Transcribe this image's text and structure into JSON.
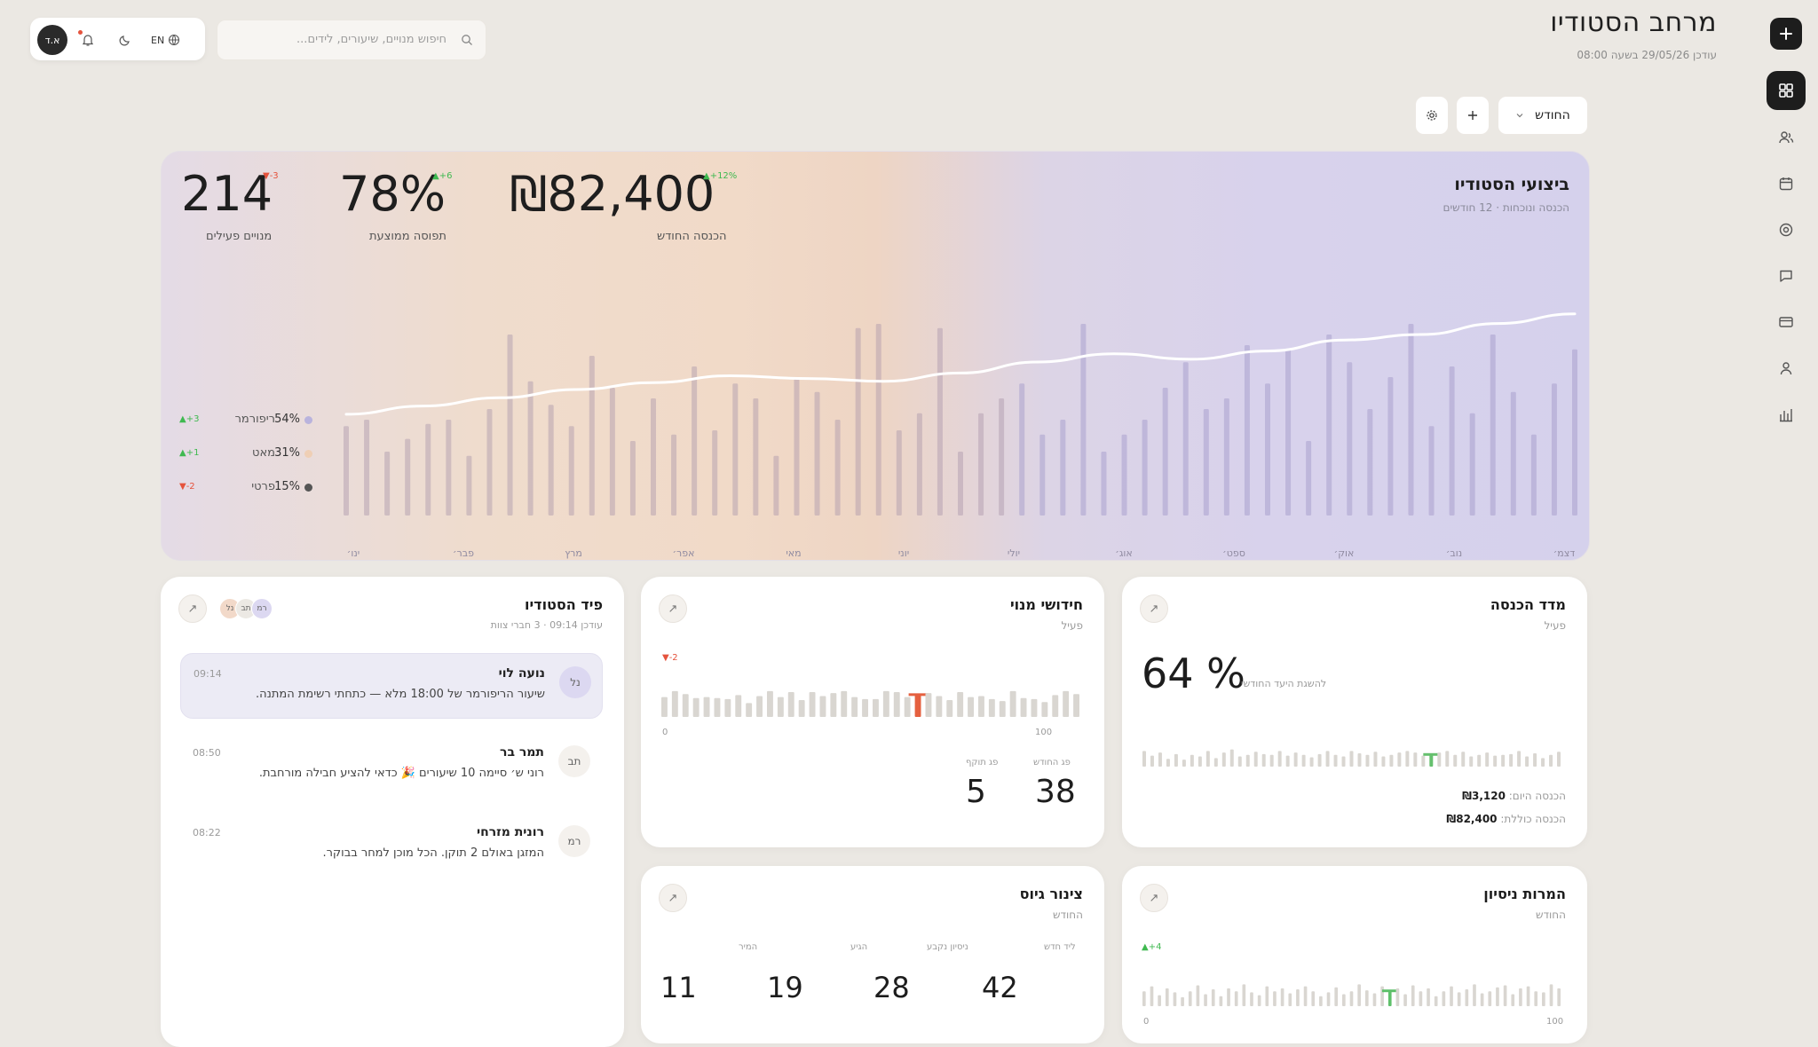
{
  "header": {
    "title": "מרחב הסטודיו",
    "updated": "עודכן 29/05/26 בשעה 08:00"
  },
  "topbar": {
    "avatar_initials": "א.ד",
    "lang": "EN",
    "search_placeholder": "חיפוש מנויים, שיעורים, לידים..."
  },
  "controls": {
    "period_label": "החודש"
  },
  "hero": {
    "title": "ביצועי הסטודיו",
    "subtitle": "הכנסה ונוכחות · 12 חודשים",
    "kpis": [
      {
        "value": "₪82,400",
        "label": "הכנסה החודש",
        "delta": "▲+12%",
        "delta_color": "#3fb950"
      },
      {
        "value": "78%",
        "label": "תפוסה ממוצעת",
        "delta": "▲+6",
        "delta_color": "#3fb950"
      },
      {
        "value": "214",
        "label": "מנויים פעילים",
        "delta": "▼-3",
        "delta_color": "#e5533d"
      }
    ],
    "legend": [
      {
        "pct": "54%",
        "name": "ריפורמר",
        "delta": "▲+3",
        "delta_color": "#3fb950",
        "dot": "#b9b3dd"
      },
      {
        "pct": "31%",
        "name": "מאט",
        "delta": "▲+1",
        "delta_color": "#3fb950",
        "dot": "#efcfb5"
      },
      {
        "pct": "15%",
        "name": "פרטי",
        "delta": "▼-2",
        "delta_color": "#e5533d",
        "dot": "#555555"
      }
    ],
    "months": [
      "ינו׳",
      "פבר׳",
      "מרץ",
      "אפר׳",
      "מאי",
      "יוני",
      "יולי",
      "אוג׳",
      "ספט׳",
      "אוק׳",
      "נוב׳",
      "דצמ׳"
    ]
  },
  "chart_data": {
    "type": "bar",
    "categories": [
      "ינו׳",
      "פבר׳",
      "מרץ",
      "אפר׳",
      "מאי",
      "יוני",
      "יולי",
      "אוג׳",
      "ספט׳",
      "אוק׳",
      "נוב׳",
      "דצמ׳"
    ],
    "bars": [
      42,
      45,
      30,
      36,
      43,
      45,
      28,
      50,
      85,
      63,
      52,
      42,
      75,
      60,
      35,
      55,
      38,
      70,
      40,
      62,
      55,
      28,
      65,
      58,
      45,
      88,
      90,
      40,
      48,
      88,
      30,
      48,
      55,
      62,
      38,
      45,
      90,
      30,
      38,
      45,
      60,
      72,
      50,
      55,
      80,
      62,
      78,
      35,
      85,
      72,
      50,
      65,
      90,
      42,
      70,
      48,
      85,
      58,
      38,
      62,
      78
    ],
    "line": [
      0.22,
      0.28,
      0.34,
      0.4,
      0.45,
      0.5,
      0.48,
      0.46,
      0.52,
      0.6,
      0.66,
      0.62,
      0.68,
      0.76,
      0.8,
      0.88,
      0.95
    ],
    "ylim": [
      0,
      100
    ]
  },
  "feed": {
    "title": "פיד הסטודיו",
    "subtitle": "עודכן 09:14 · 3 חברי צוות",
    "team": [
      "נל",
      "תב",
      "רמ"
    ],
    "items": [
      {
        "initials": "נל",
        "name": "נועה לוי",
        "msg": "שיעור הריפורמר של 18:00 מלא — כתחתי רשימת המתנה.",
        "time": "09:14"
      },
      {
        "initials": "תב",
        "name": "תמר בר",
        "msg": "רוני ש׳ סיימה 10 שיעורים 🎉 כדאי להציע חבילה מורחבת.",
        "time": "08:50"
      },
      {
        "initials": "רמ",
        "name": "רונית מזרחי",
        "msg": "המזגן באולם 2 תוקן. הכל מוכן למחר בבוקר.",
        "time": "08:22"
      }
    ]
  },
  "renewals": {
    "title": "חידושי מנוי",
    "subtitle": "פעיל",
    "delta": "▼-2",
    "axis_min": "0",
    "axis_max": "100",
    "label_new": "פג החודש",
    "label_expired": "פג תוקף",
    "value_new": "38",
    "value_expired": "5",
    "bars": [
      40,
      52,
      46,
      38,
      40,
      38,
      36,
      44,
      28,
      42,
      52,
      40,
      50,
      34,
      50,
      42,
      48,
      52,
      40,
      36,
      36,
      52,
      50,
      40,
      44,
      48,
      42,
      34,
      50,
      40,
      42,
      36,
      32,
      52,
      38,
      36,
      30,
      44,
      52,
      46
    ],
    "highlight": 24
  },
  "revenue_gauge": {
    "title": "מדד הכנסה",
    "subtitle": "פעיל",
    "value": "64 %",
    "note": "להשגת היעד החודשי",
    "today_label": "הכנסה היום:",
    "today_value": "₪3,120",
    "total_label": "הכנסה כוללת:",
    "total_value": "₪82,400",
    "bars": [
      40,
      28,
      36,
      20,
      32,
      18,
      30,
      26,
      40,
      22,
      36,
      44,
      26,
      30,
      38,
      32,
      30,
      40,
      28,
      36,
      30,
      24,
      32,
      40,
      30,
      26,
      40,
      34,
      30,
      38,
      26,
      30,
      36,
      40,
      36,
      28,
      30,
      36,
      40,
      30,
      38,
      26,
      30,
      36,
      28,
      30,
      32,
      40,
      26,
      34,
      22,
      30,
      38
    ],
    "highlight": 36
  },
  "pipeline": {
    "title": "צינור גיוס",
    "subtitle": "החודש",
    "stages": [
      {
        "label": "ליד חדש",
        "value": "42"
      },
      {
        "label": "ניסיון נקבע",
        "value": "28"
      },
      {
        "label": "הגיע",
        "value": "19"
      },
      {
        "label": "המיר",
        "value": "11"
      }
    ]
  },
  "trials": {
    "title": "המרות ניסיון",
    "subtitle": "החודש",
    "delta": "▲+4",
    "axis_min": "0",
    "axis_max": "100",
    "bars": [
      30,
      40,
      22,
      36,
      28,
      18,
      30,
      42,
      24,
      34,
      20,
      36,
      30,
      44,
      28,
      22,
      40,
      30,
      36,
      26,
      34,
      40,
      30,
      20,
      28,
      38,
      24,
      30,
      44,
      32,
      26,
      40,
      30,
      36,
      24,
      42,
      30,
      36,
      20,
      30,
      40,
      28,
      34,
      44,
      26,
      30,
      38,
      42,
      24,
      36,
      40,
      30,
      28,
      44,
      36
    ],
    "highlight": 32
  }
}
